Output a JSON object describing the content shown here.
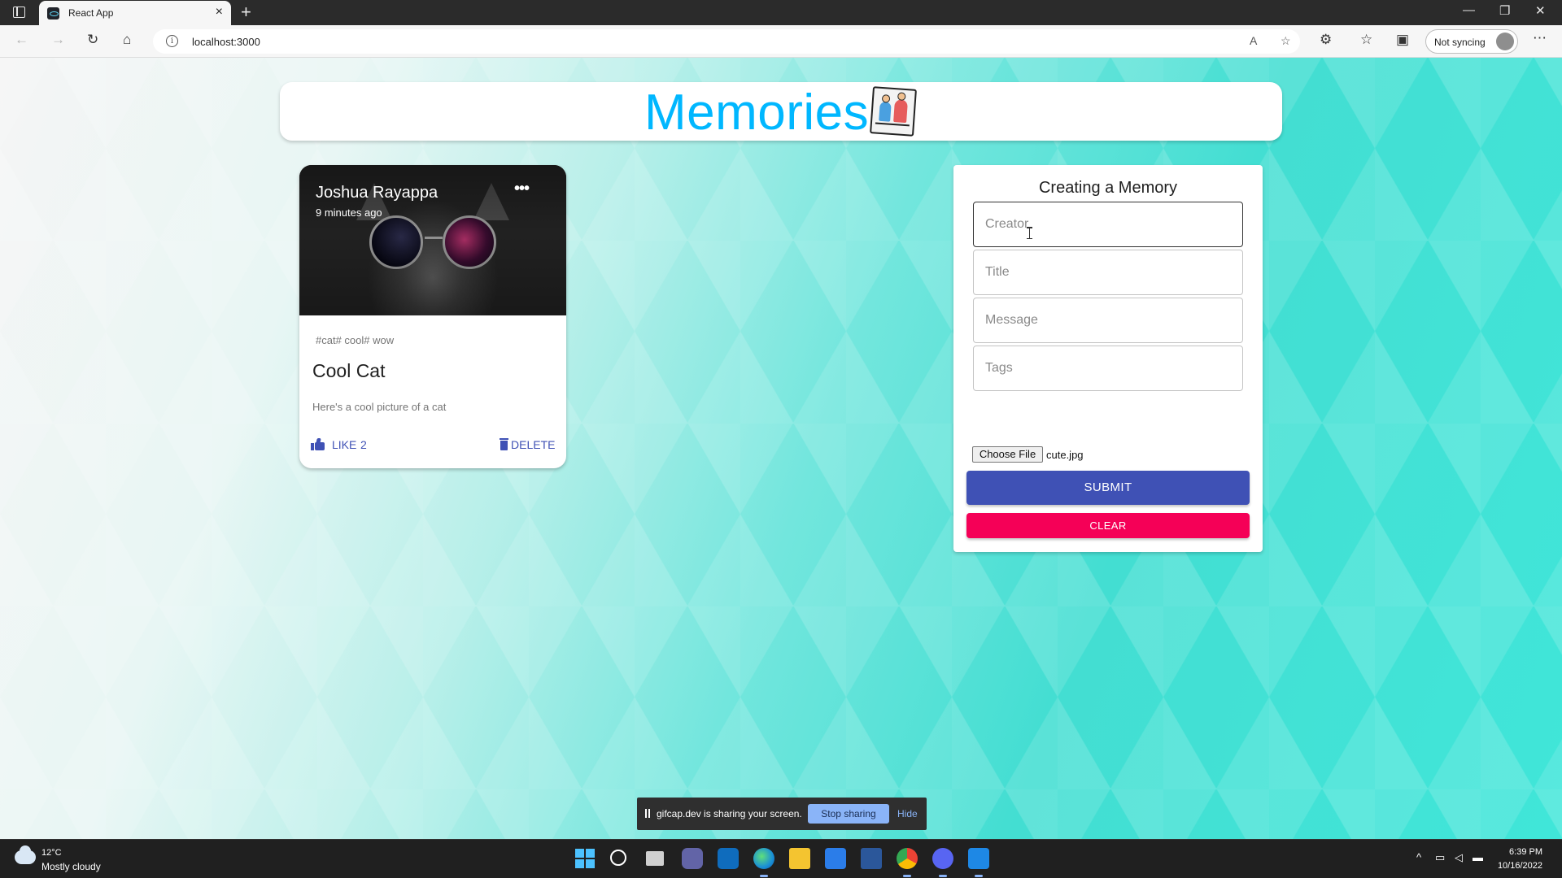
{
  "browser": {
    "tab_title": "React App",
    "url": "localhost:3000",
    "sync_label": "Not syncing"
  },
  "app": {
    "brand": "Memories"
  },
  "post": {
    "creator": "Joshua Rayappa",
    "time_ago": "9 minutes ago",
    "tags": "#cat# cool# wow",
    "title": "Cool Cat",
    "message": "Here's a cool picture of a cat",
    "like_label": "LIKE",
    "like_count": "2",
    "delete_label": "DELETE",
    "more_label": "•••"
  },
  "form": {
    "title": "Creating a Memory",
    "creator_placeholder": "Creator",
    "title_placeholder": "Title",
    "message_placeholder": "Message",
    "tags_placeholder": "Tags",
    "file_button": "Choose File",
    "file_name": "cute.jpg",
    "submit_label": "SUBMIT",
    "clear_label": "CLEAR"
  },
  "sharebar": {
    "text": "gifcap.dev is sharing your screen.",
    "stop_label": "Stop sharing",
    "hide_label": "Hide"
  },
  "taskbar": {
    "temperature": "12°C",
    "condition": "Mostly cloudy",
    "time": "6:39 PM",
    "date": "10/16/2022"
  },
  "colors": {
    "primary": "#3f51b5",
    "secondary": "#f50057",
    "brand": "#00b7ff"
  }
}
